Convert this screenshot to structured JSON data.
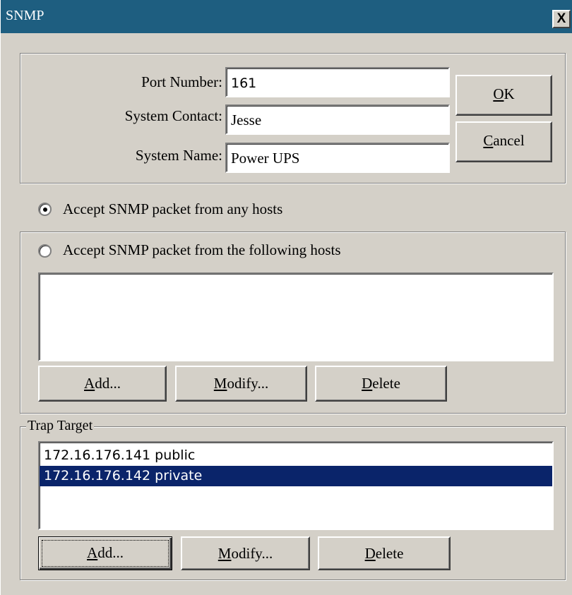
{
  "window": {
    "title": "SNMP",
    "close_label": "X"
  },
  "settings": {
    "port_label": "Port Number:",
    "port_value": "161",
    "contact_label": "System Contact:",
    "contact_value": "Jesse",
    "name_label": "System Name:",
    "name_value": "Power UPS"
  },
  "buttons": {
    "ok": {
      "pre": "",
      "accel": "O",
      "post": "K"
    },
    "cancel": {
      "pre": "",
      "accel": "C",
      "post": "ancel"
    }
  },
  "access": {
    "any_hosts_label": "Accept SNMP packet from any hosts",
    "any_hosts_selected": true,
    "following_hosts_label": "Accept SNMP packet from the following hosts",
    "following_hosts_selected": false,
    "hosts": [],
    "add": {
      "pre": "",
      "accel": "A",
      "post": "dd..."
    },
    "modify": {
      "pre": "",
      "accel": "M",
      "post": "odify..."
    },
    "delete": {
      "pre": "",
      "accel": "D",
      "post": "elete"
    }
  },
  "trap": {
    "legend": "Trap Target",
    "targets": [
      {
        "text": "172.16.176.141 public",
        "selected": false
      },
      {
        "text": "172.16.176.142 private",
        "selected": true
      }
    ],
    "add": {
      "pre": "",
      "accel": "A",
      "post": "dd..."
    },
    "modify": {
      "pre": "",
      "accel": "M",
      "post": "odify..."
    },
    "delete": {
      "pre": "",
      "accel": "D",
      "post": "elete"
    }
  },
  "colors": {
    "titlebar": "#1e5e80",
    "face": "#d4d0c8",
    "selection": "#0a246a"
  }
}
